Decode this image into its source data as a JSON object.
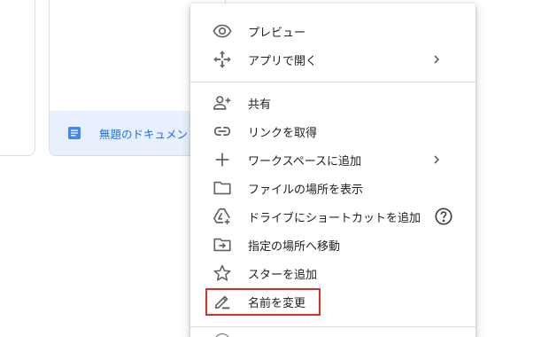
{
  "background": {
    "file_card": {
      "title": "無題のドキュメント",
      "icon": "google-docs-icon",
      "accent_color": "#1a73e8",
      "footer_color": "#e8f0fe"
    }
  },
  "context_menu": {
    "items": [
      {
        "label": "プレビュー",
        "icon": "eye-icon"
      },
      {
        "label": "アプリで開く",
        "icon": "move-arrows-icon",
        "submenu": true
      },
      {
        "label": "共有",
        "icon": "add-person-icon"
      },
      {
        "label": "リンクを取得",
        "icon": "link-icon"
      },
      {
        "label": "ワークスペースに追加",
        "icon": "plus-icon",
        "submenu": true
      },
      {
        "label": "ファイルの場所を表示",
        "icon": "folder-icon"
      },
      {
        "label": "ドライブにショートカットを追加",
        "icon": "drive-add-shortcut-icon",
        "help": true
      },
      {
        "label": "指定の場所へ移動",
        "icon": "move-to-folder-icon"
      },
      {
        "label": "スターを追加",
        "icon": "star-icon"
      },
      {
        "label": "名前を変更",
        "icon": "rename-pencil-icon",
        "highlighted": true
      }
    ]
  },
  "colors": {
    "highlight_border": "#d93025",
    "icon_gray": "#5f6368",
    "divider": "#dadce0"
  }
}
